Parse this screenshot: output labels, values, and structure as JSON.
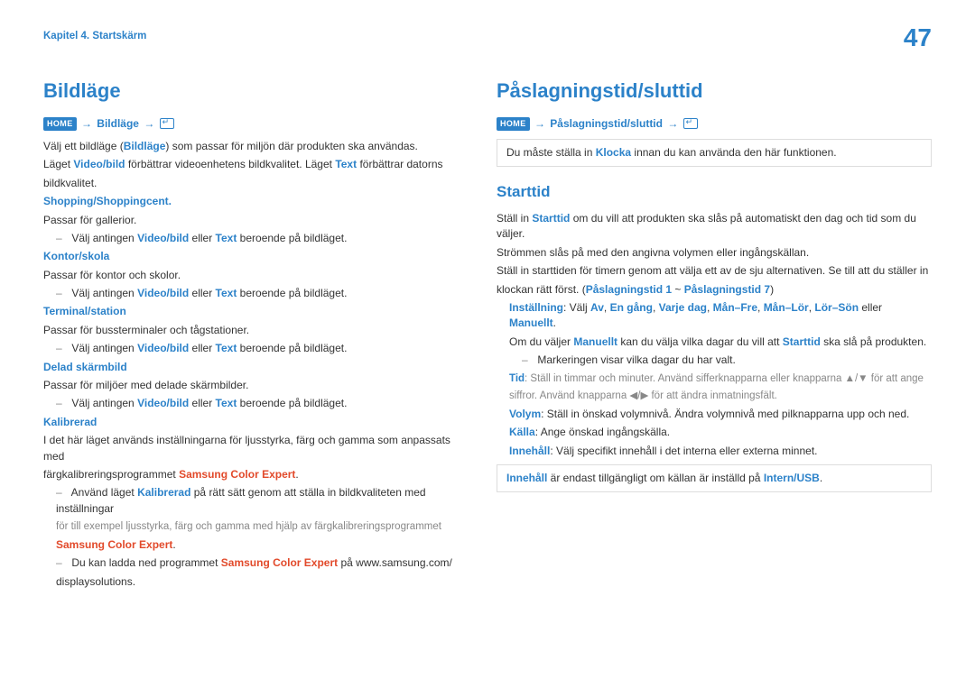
{
  "header": {
    "chapter": "Kapitel 4. Startskärm",
    "page_number": "47"
  },
  "left": {
    "heading": "Bildläge",
    "home_tag": "HOME",
    "bc_item": "Bildläge",
    "intro_prefix": "Välj ett bildläge (",
    "intro_hl": "Bildläge",
    "intro_suffix": ") som passar för miljön där produkten ska användas.",
    "intro2_prefix": "Läget ",
    "intro2_vb": "Video/bild",
    "intro2_mid": " förbättrar videoenhetens bildkvalitet. Läget ",
    "intro2_text": "Text",
    "intro2_suffix": " förbättrar datorns",
    "intro2_line3": "bildkvalitet.",
    "modes": {
      "shopping": {
        "title": "Shopping/Shoppingcent.",
        "line1": "Passar för gallerior.",
        "line2_prefix": "Välj antingen ",
        "line2_mid": " eller ",
        "line2_suffix": " beroende på bildläget."
      },
      "kontor": {
        "title": "Kontor/skola",
        "line1": "Passar för kontor och skolor.",
        "line2_prefix": "Välj antingen ",
        "line2_mid": " eller ",
        "line2_suffix": " beroende på bildläget."
      },
      "terminal": {
        "title": "Terminal/station",
        "line1": "Passar för bussterminaler och tågstationer.",
        "line2_prefix": "Välj antingen ",
        "line2_mid": " eller ",
        "line2_suffix": " beroende på bildläget."
      },
      "delad": {
        "title": "Delad skärmbild",
        "line1": "Passar för miljöer med delade skärmbilder.",
        "line2_prefix": "Välj antingen ",
        "line2_mid": " eller ",
        "line2_suffix": " beroende på bildläget."
      },
      "kalibrerad": {
        "title": "Kalibrerad",
        "line1": "I det här läget används inställningarna för ljusstyrka, färg och gamma som anpassats med",
        "line1_suffix_pre": "färgkalibreringsprogrammet ",
        "line1_suffix_hl": "Samsung Color Expert",
        "line1_suffix_post": ".",
        "b1_pre": "Använd läget ",
        "b1_mid": " på rätt sätt genom att ställa in bildkvaliteten med inställningar",
        "b1_gray": "för till exempel ljusstyrka, färg och gamma med hjälp av färgkalibreringsprogrammet",
        "b1_orange_end": "Samsung Color Expert",
        "b1_dotend": ".",
        "b2_pre": "Du kan ladda ned programmet ",
        "b2_mid": " på www.samsung.com/",
        "b2_line2": "displaysolutions."
      }
    },
    "tokens": {
      "video": "Video/bild",
      "text": "Text"
    }
  },
  "right": {
    "heading": "Påslagningstid/sluttid",
    "home_tag": "HOME",
    "bc_item": "Påslagningstid/sluttid",
    "note_pre": "Du måste ställa in ",
    "note_hl": "Klocka",
    "note_post": " innan du kan använda den här funktionen.",
    "subheading": "Starttid",
    "p1_pre": "Ställ in ",
    "p1_hl": "Starttid",
    "p1_post": " om du vill att produkten ska slås på automatiskt den dag och tid som du väljer.",
    "p2": "Strömmen slås på med den angivna volymen eller ingångskällan.",
    "p3_line1": "Ställ in starttiden för timern genom att välja ett av de sju alternativen. Se till att du ställer in",
    "p3_prefix": "klockan rätt först. (",
    "p3_hl1": "Påslagningstid 1",
    "p3_tilde": " ~ ",
    "p3_hl2": "Påslagningstid 7",
    "p3_close": ")",
    "s_inst_label": "Inställning",
    "s_inst_prefix": ": Välj ",
    "s_inst_opts": [
      "Av",
      "En gång",
      "Varje dag",
      "Mån–Fre",
      "Mån–Lör",
      "Lör–Sön"
    ],
    "s_inst_sep": ", ",
    "s_inst_or": " eller ",
    "s_inst_last": "Manuellt",
    "s_inst_dot": ".",
    "s_inst_line2_pre": "Om du väljer ",
    "s_inst_line2_mid": " kan du välja vilka dagar du vill att ",
    "s_inst_line2_hl": "Starttid",
    "s_inst_line2_post": " ska slå på produkten.",
    "s_inst_check": "Markeringen visar vilka dagar du har valt.",
    "s_tid_label": "Tid",
    "s_tid_gray1": ": Ställ in timmar och minuter. Använd sifferknapparna eller knapparna ▲/▼ för att ange",
    "s_tid_gray2": "siffror. Använd knapparna ◀/▶ för att ändra inmatningsfält.",
    "s_vol_label": "Volym",
    "s_vol_text": ": Ställ in önskad volymnivå. Ändra volymnivå med pilknapparna upp och ned.",
    "s_kalla_label": "Källa",
    "s_kalla_text": ": Ange önskad ingångskälla.",
    "s_innehall_label": "Innehåll",
    "s_innehall_text": ": Välj specifikt innehåll i det interna eller externa minnet.",
    "note2_hl": "Innehåll",
    "note2_mid": " är endast tillgängligt om källan är inställd på ",
    "note2_hl2": "Intern/USB",
    "note2_dot": "."
  }
}
